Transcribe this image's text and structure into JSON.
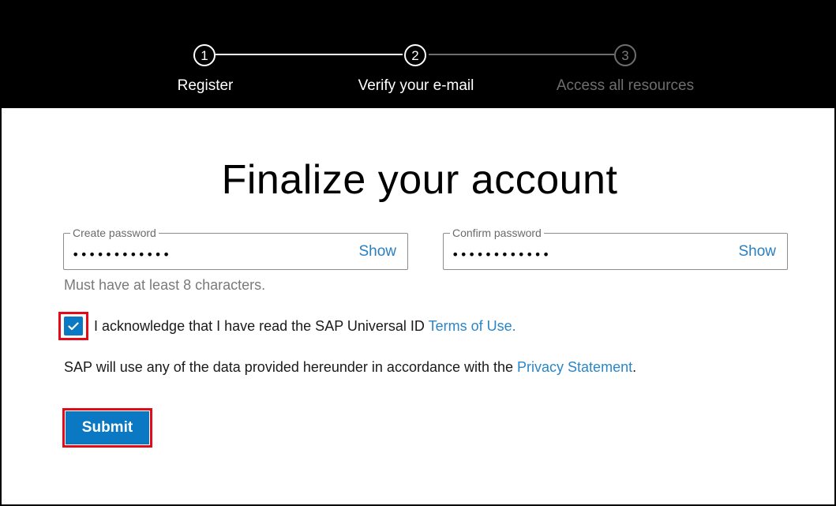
{
  "stepper": {
    "steps": [
      {
        "number": "1",
        "label": "Register",
        "state": "done"
      },
      {
        "number": "2",
        "label": "Verify your e-mail",
        "state": "current"
      },
      {
        "number": "3",
        "label": "Access all resources",
        "state": "upcoming"
      }
    ]
  },
  "form": {
    "title": "Finalize your account",
    "create_password": {
      "label": "Create password",
      "value": "••••••••••••",
      "show_label": "Show"
    },
    "confirm_password": {
      "label": "Confirm password",
      "value": "••••••••••••",
      "show_label": "Show"
    },
    "hint": "Must have at least 8 characters.",
    "terms": {
      "checked": true,
      "text": "I acknowledge that I have read the SAP Universal ID ",
      "link": "Terms of Use."
    },
    "privacy": {
      "text": "SAP will use any of the data provided hereunder in accordance with the ",
      "link": "Privacy Statement",
      "suffix": "."
    },
    "submit_label": "Submit"
  },
  "colors": {
    "accent": "#0a78c2",
    "link": "#2a86c8",
    "highlight": "#e30b17",
    "header_bg": "#000000"
  }
}
